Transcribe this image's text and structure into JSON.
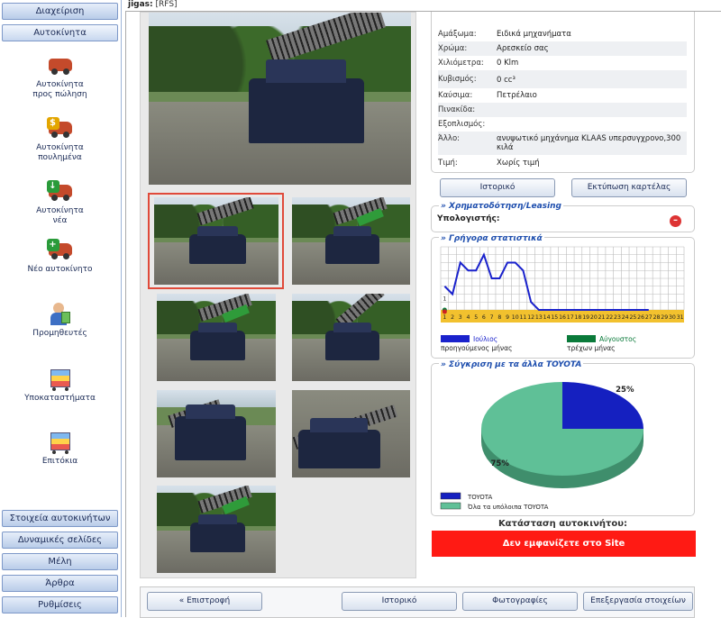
{
  "sidebar": {
    "top": [
      "Διαχείριση",
      "Αυτοκίνητα"
    ],
    "items": [
      {
        "label": "Αυτοκίνητα\nπρος πώληση",
        "icon": "car-for-sale-icon"
      },
      {
        "label": "Αυτοκίνητα\nπουλημένα",
        "icon": "car-sold-icon"
      },
      {
        "label": "Αυτοκίνητα\nνέα",
        "icon": "car-new-icon"
      },
      {
        "label": "Νέο αυτοκίνητο",
        "icon": "add-car-icon"
      },
      {
        "label": "Προμηθευτές",
        "icon": "supplier-icon"
      },
      {
        "label": "Υποκαταστήματα",
        "icon": "branches-icon"
      },
      {
        "label": "Επιτόκια",
        "icon": "rates-icon"
      }
    ],
    "bottom": [
      "Στοιχεία αυτοκινήτων",
      "Δυναμικές σελίδες",
      "Μέλη",
      "Άρθρα",
      "Ρυθμίσεις"
    ]
  },
  "topbar": {
    "user": "jigas:",
    "tag": "[RFS]"
  },
  "details": [
    {
      "k": "Αμάξωμα:",
      "v": "Ειδικά μηχανήματα"
    },
    {
      "k": "Χρώμα:",
      "v": "Αρεσκείο σας"
    },
    {
      "k": "Χιλιόμετρα:",
      "v": "0 Klm"
    },
    {
      "k": "Κυβισμός:",
      "v": "0 cc³"
    },
    {
      "k": "Καύσιμα:",
      "v": "Πετρέλαιο"
    },
    {
      "k": "Πινακίδα:",
      "v": ""
    },
    {
      "k": "Εξοπλισμός:",
      "v": ""
    },
    {
      "k": "Άλλο:",
      "v": "ανυψωτικό μηχάνημα KLAAS υπερσυγχρονο,300 κιλά"
    },
    {
      "k": "Τιμή:",
      "v": "Χωρίς τιμή"
    }
  ],
  "buttons": {
    "history": "Ιστορικό",
    "print": "Εκτύπωση καρτέλας",
    "back": "« Επιστροφή",
    "history2": "Ιστορικό",
    "photos": "Φωτογραφίες",
    "edit": "Επεξεργασία στοιχείων"
  },
  "finance": {
    "title": "» Χρηματοδότηση/Leasing",
    "calc": "Υπολογιστής:"
  },
  "stats": {
    "title": "» Γρήγορα στατιστικά"
  },
  "compare": {
    "title": "» Σύγκριση με τα άλλα TOYOTA"
  },
  "status": {
    "label": "Κατάσταση αυτοκινήτου:",
    "value": "Δεν εμφανίζετε στο Site"
  },
  "chart_data": [
    {
      "type": "line",
      "title": "» Γρήγορα στατιστικά",
      "categories": [
        "1",
        "2",
        "3",
        "4",
        "5",
        "6",
        "7",
        "8",
        "9",
        "10",
        "11",
        "12",
        "13",
        "14",
        "15",
        "16",
        "17",
        "18",
        "19",
        "20",
        "21",
        "22",
        "23",
        "24",
        "25",
        "26",
        "27",
        "28",
        "29",
        "30",
        "31"
      ],
      "series": [
        {
          "name": "Ιούλιος",
          "subtitle": "προηγούμενος μήνας",
          "color": "#1a22cc",
          "values": [
            3,
            2,
            6,
            5,
            5,
            7,
            4,
            4,
            6,
            6,
            5,
            1,
            0,
            0,
            0,
            0,
            0,
            0,
            0,
            0,
            0,
            0,
            0,
            0,
            0,
            0,
            0,
            null,
            null,
            null,
            null
          ]
        },
        {
          "name": "Αύγουστος",
          "subtitle": "τρέχων μήνας",
          "color": "#0a7a3a",
          "values": [
            0,
            null,
            null,
            null,
            null,
            null,
            null,
            null,
            null,
            null,
            null,
            null,
            null,
            null,
            null,
            null,
            null,
            null,
            null,
            null,
            null,
            null,
            null,
            null,
            null,
            null,
            null,
            null,
            null,
            null,
            null
          ]
        }
      ],
      "annotation": "1",
      "ylim": [
        0,
        8
      ],
      "grid": true
    },
    {
      "type": "pie",
      "title": "» Σύγκριση με τα άλλα TOYOTA",
      "slices": [
        {
          "label": "TOYOTA",
          "value": 25,
          "color": "#1520c0",
          "text": "25%"
        },
        {
          "label": "Όλα τα υπόλοιπα TOYOTA",
          "value": 75,
          "color": "#5fc097",
          "text": "75%"
        }
      ]
    }
  ]
}
